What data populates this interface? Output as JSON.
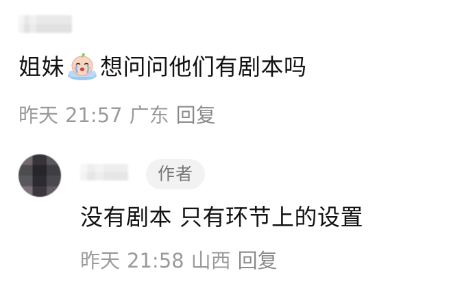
{
  "comments": [
    {
      "text_before_emoji": "姐妹",
      "emoji": "crying-face-emoji",
      "text_after_emoji": "想问问他们有剧本吗",
      "date": "昨天",
      "time": "21:57",
      "location": "广东",
      "reply_label": "回复"
    },
    {
      "author_badge": "作者",
      "text": "没有剧本 只有环节上的设置",
      "date": "昨天",
      "time": "21:58",
      "location": "山西",
      "reply_label": "回复"
    }
  ]
}
